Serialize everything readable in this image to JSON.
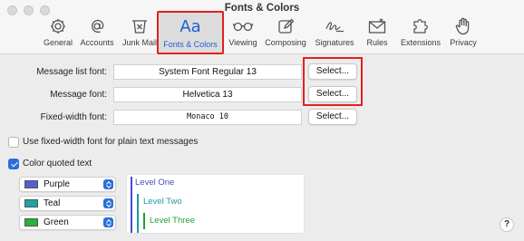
{
  "window": {
    "title": "Fonts & Colors"
  },
  "toolbar": {
    "items": [
      {
        "label": "General",
        "icon": "gear-icon"
      },
      {
        "label": "Accounts",
        "icon": "at-sign-icon"
      },
      {
        "label": "Junk Mail",
        "icon": "junk-mail-icon"
      },
      {
        "label": "Fonts & Colors",
        "icon": "font-aa-icon",
        "selected": true
      },
      {
        "label": "Viewing",
        "icon": "glasses-icon"
      },
      {
        "label": "Composing",
        "icon": "compose-icon"
      },
      {
        "label": "Signatures",
        "icon": "signature-icon"
      },
      {
        "label": "Rules",
        "icon": "rules-envelope-icon"
      },
      {
        "label": "Extensions",
        "icon": "puzzle-icon"
      },
      {
        "label": "Privacy",
        "icon": "hand-icon"
      }
    ],
    "aa_glyph": "Aa"
  },
  "fonts": {
    "message_list": {
      "label": "Message list font:",
      "value": "System Font Regular 13",
      "button": "Select..."
    },
    "message": {
      "label": "Message font:",
      "value": "Helvetica 13",
      "button": "Select..."
    },
    "fixed_width": {
      "label": "Fixed-width font:",
      "value": "Monaco 10",
      "button": "Select..."
    }
  },
  "options": {
    "use_fixed_width": {
      "label": "Use fixed-width font for plain text messages",
      "checked": false
    },
    "color_quoted": {
      "label": "Color quoted text",
      "checked": true
    }
  },
  "quote_colors": [
    {
      "name": "Purple",
      "color": "#5b5bd6"
    },
    {
      "name": "Teal",
      "color": "#1aa3a8"
    },
    {
      "name": "Green",
      "color": "#25b33a"
    }
  ],
  "preview": {
    "levels": [
      {
        "text": "Level One",
        "color": "#4a4ac9"
      },
      {
        "text": "Level Two",
        "color": "#1b9aa3"
      },
      {
        "text": "Level Three",
        "color": "#1fa22f"
      }
    ]
  },
  "help": {
    "label": "?"
  },
  "accent": "#2a6fdb",
  "highlight": "#e0221f"
}
